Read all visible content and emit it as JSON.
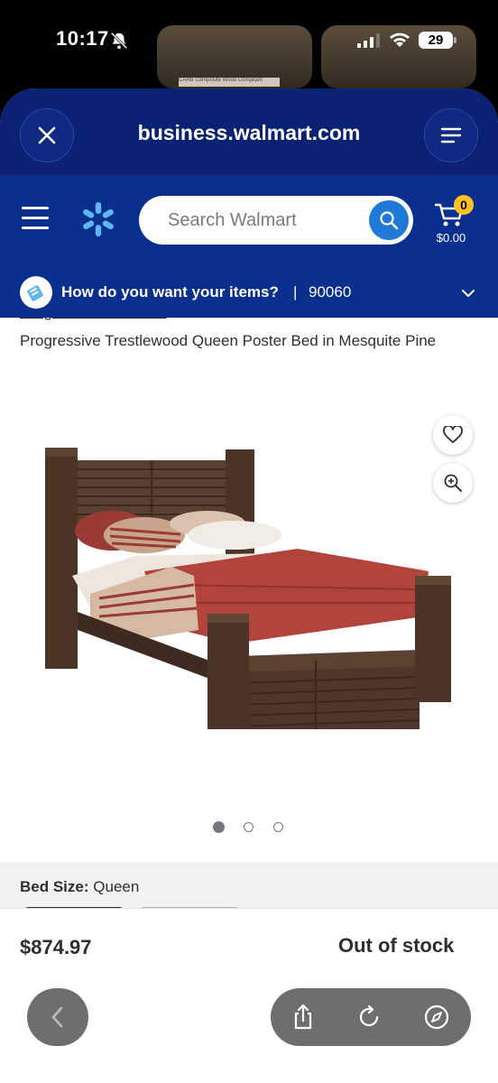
{
  "status_bar": {
    "time": "10:17",
    "battery": "29",
    "bg_label": "CARB Composite Wood Compliant"
  },
  "browser": {
    "url": "business.walmart.com"
  },
  "header": {
    "search_placeholder": "Search Walmart",
    "cart_count": "0",
    "cart_total": "$0.00",
    "brand_color": "#0b2f8f",
    "accent_color": "#ffc220"
  },
  "delivery": {
    "question": "How do you want your items?",
    "separator": "|",
    "zip": "90060"
  },
  "product": {
    "brand": "Progressive Furniture",
    "title": "Progressive Trestlewood Queen Poster Bed in Mesquite Pine",
    "image_icon": "bed-product-image",
    "carousel_pages": 3,
    "carousel_active": 1
  },
  "options": {
    "size_label": "Bed Size:",
    "size_value": "Queen"
  },
  "buy": {
    "price": "$874.97",
    "stock_status": "Out of stock"
  }
}
